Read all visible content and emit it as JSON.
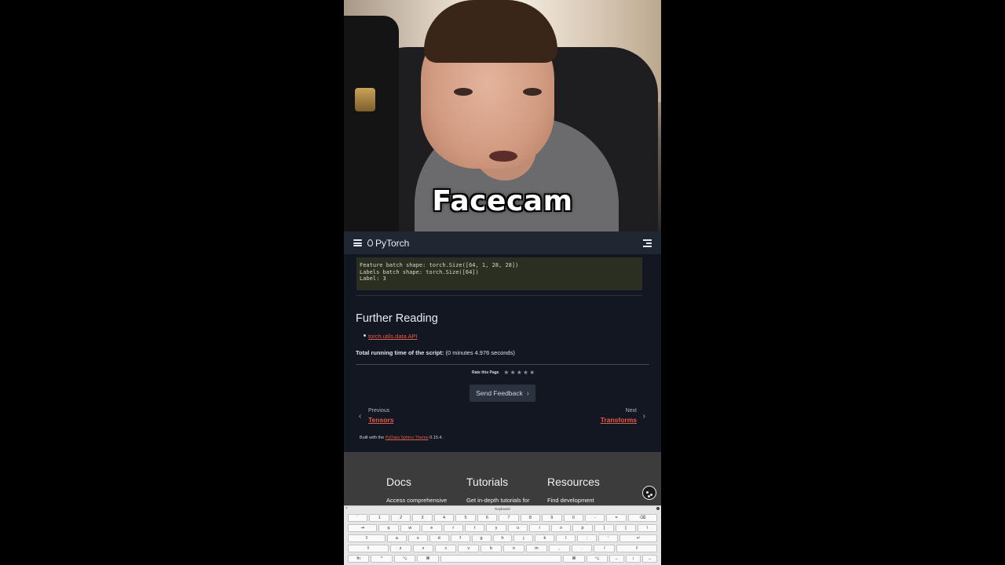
{
  "facecam": {
    "label": "Facecam"
  },
  "navbar": {
    "brand": "PyTorch"
  },
  "code_output": {
    "lines": [
      "Feature batch shape: torch.Size([64, 1, 28, 28])",
      "Labels batch shape: torch.Size([64])",
      "Label: 3"
    ]
  },
  "content": {
    "section_title": "Further Reading",
    "links": [
      "torch.utils.data API"
    ],
    "runtime_label": "Total running time of the script:",
    "runtime_value": " (0 minutes 4.976 seconds)",
    "rate_label": "Rate this Page",
    "stars": [
      "★",
      "★",
      "★",
      "★",
      "★"
    ],
    "feedback_button": "Send Feedback",
    "prev": {
      "label": "Previous",
      "title": "Tensors"
    },
    "next": {
      "label": "Next",
      "title": "Transforms"
    },
    "built_with_prefix": "Built with the ",
    "built_with_link": "PyData Sphinx Theme",
    "built_with_suffix": " 0.15.4."
  },
  "footer": {
    "columns": [
      {
        "title": "Docs",
        "desc": "Access comprehensive"
      },
      {
        "title": "Tutorials",
        "desc": "Get in-depth tutorials for"
      },
      {
        "title": "Resources",
        "desc": "Find development"
      }
    ]
  },
  "keyboard": {
    "title": "Keyboard",
    "rows": [
      [
        "`",
        "1",
        "2",
        "3",
        "4",
        "5",
        "6",
        "7",
        "8",
        "9",
        "0",
        "-",
        "=",
        "⌫"
      ],
      [
        "⇥",
        "q",
        "w",
        "e",
        "r",
        "t",
        "y",
        "u",
        "i",
        "o",
        "p",
        "[",
        "]",
        "\\"
      ],
      [
        "⇪",
        "a",
        "s",
        "d",
        "f",
        "g",
        "h",
        "j",
        "k",
        "l",
        ";",
        "'",
        "↵"
      ],
      [
        "⇧",
        "z",
        "x",
        "c",
        "v",
        "b",
        "n",
        "m",
        ",",
        ".",
        "/",
        "⇧"
      ],
      [
        "fn",
        "^",
        "⌥",
        "⌘",
        "",
        "⌘",
        "⌥",
        "←",
        "↕",
        "→"
      ]
    ]
  }
}
